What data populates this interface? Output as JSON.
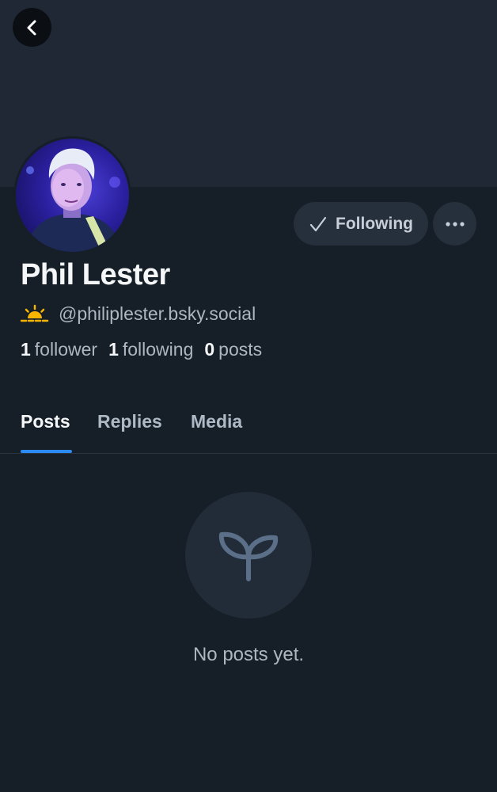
{
  "colors": {
    "background": "#161e27",
    "banner": "#1f2834",
    "accent": "#2b8bf2",
    "muted_text": "#aeb6c2"
  },
  "header": {
    "back_icon": "chevron-left-icon"
  },
  "profile": {
    "display_name": "Phil Lester",
    "handle": "@philiplester.bsky.social",
    "handle_emoji": "sunrise-icon",
    "avatar": "avatar-photo",
    "following_button": {
      "label": "Following",
      "icon": "checkmark-icon"
    },
    "more_button": {
      "icon": "ellipsis-icon"
    }
  },
  "stats": {
    "followers_count": "1",
    "followers_label": "follower",
    "following_count": "1",
    "following_label": "following",
    "posts_count": "0",
    "posts_label": "posts"
  },
  "tabs": [
    {
      "label": "Posts",
      "active": true
    },
    {
      "label": "Replies",
      "active": false
    },
    {
      "label": "Media",
      "active": false
    }
  ],
  "empty_state": {
    "icon": "sprout-icon",
    "message": "No posts yet."
  }
}
